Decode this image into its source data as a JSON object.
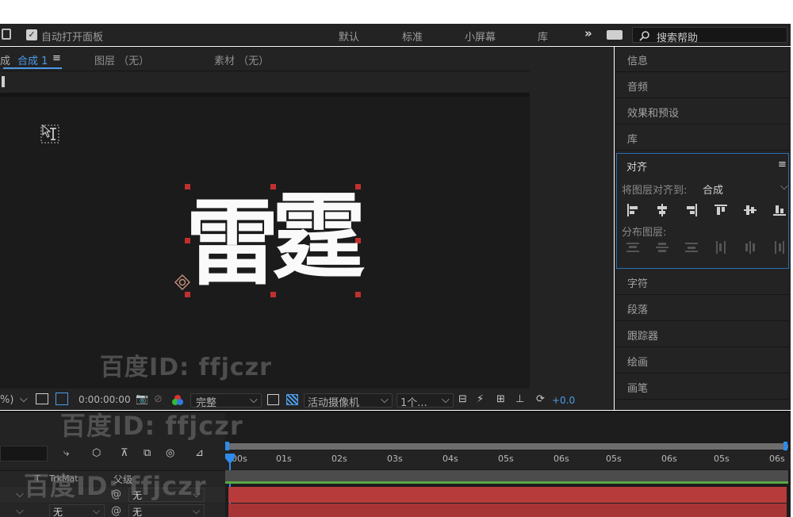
{
  "topbar": {
    "auto_open_label": "自动打开面板",
    "workspaces": [
      "默认",
      "标准",
      "小屏幕",
      "库"
    ],
    "more": "»",
    "search_placeholder": "搜索帮助"
  },
  "tabs": {
    "comp_prefix": "成",
    "comp_tab": "合成 1",
    "menu": "≡",
    "layer_tab": "图层 （无）",
    "footage_tab": "素材 （无）"
  },
  "composition": {
    "chars": [
      "雷",
      "霆"
    ]
  },
  "viewer_bar": {
    "zoom": "%)",
    "timecode": "0:00:00:00",
    "resolution": "完整",
    "camera": "活动摄像机",
    "views": "1个...",
    "exposure": "+0.0"
  },
  "right_panels": {
    "info": "信息",
    "audio": "音频",
    "effects": "效果和预设",
    "library": "库",
    "align": {
      "title": "对齐",
      "menu": "≡",
      "align_to_label": "将图层对齐到:",
      "align_to_value": "合成",
      "distribute_label": "分布图层:"
    },
    "character": "字符",
    "paragraph": "段落",
    "tracker": "跟踪器",
    "paint": "绘画",
    "brush": "画笔"
  },
  "timeline": {
    "columns": {
      "t": "T",
      "trkmat": "TrkMat",
      "parent": "父级"
    },
    "rows": [
      {
        "parent": "无"
      },
      {
        "trkmat": "无",
        "parent": "无"
      }
    ],
    "ruler": [
      "00s",
      "01s",
      "02s",
      "03s",
      "04s",
      "05s",
      "06s",
      "05s",
      "06s",
      "05s",
      "06s"
    ],
    "colors": {
      "layer_bar": "#b83b3c",
      "work_area": "#5aa845",
      "playhead": "#2d8ceb"
    }
  },
  "watermark": "百度ID: ffjczr"
}
